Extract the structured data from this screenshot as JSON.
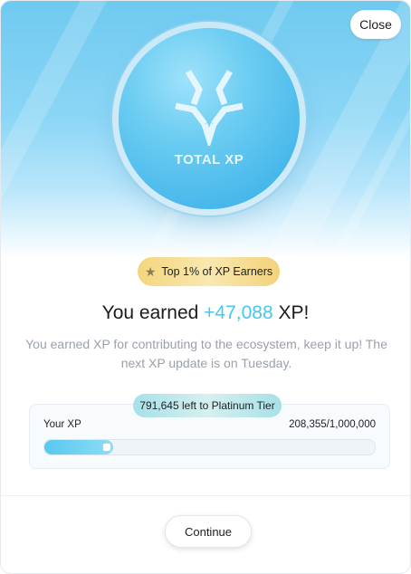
{
  "modal": {
    "close_label": "Close",
    "coin_label": "TOTAL XP",
    "badge_label": "Top 1% of XP Earners",
    "headline_prefix": "You earned ",
    "headline_amount": "+47,088",
    "headline_suffix": " XP!",
    "description": "You earned XP for contributing to the ecosystem, keep it up! The next XP update is on Tuesday.",
    "tier_pill": "791,645 left to Platinum Tier",
    "xp_label": "Your XP",
    "xp_value": "208,355/1,000,000",
    "xp_progress_fraction": 0.208355,
    "continue_label": "Continue"
  },
  "colors": {
    "accent": "#47c6ee",
    "badge_gold": "#f5d57e",
    "hero_blue": "#6fcaf0"
  },
  "icons": [
    "logo-icon",
    "star-icon"
  ]
}
